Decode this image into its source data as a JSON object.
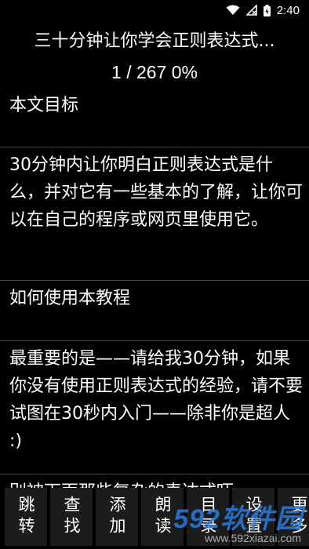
{
  "status_bar": {
    "time": "2:40",
    "icons": [
      "wifi-icon",
      "signal-icon",
      "battery-icon"
    ]
  },
  "header": {
    "title": "三十分钟让你学会正则表达式...",
    "progress": "1 / 267 0%"
  },
  "paragraphs": [
    "本文目标",
    "30分钟内让你明白正则表达式是什么，并对它有一些基本的了解，让你可以在自己的程序或网页里使用它。",
    "如何使用本教程",
    "最重要的是——请给我30分钟，如果你没有使用正则表达式的经验，请不要试图在30秒内入门——除非你是超人 :)",
    "别被下面那些复杂的表达式吓"
  ],
  "toolbar": [
    {
      "label": "跳转"
    },
    {
      "label": "查找"
    },
    {
      "label": "添加"
    },
    {
      "label": "朗读"
    },
    {
      "label": "目录"
    },
    {
      "label": "设置"
    },
    {
      "label": "更多"
    }
  ],
  "watermark": {
    "logo": "592软件园",
    "url": "www.592xiazai.com"
  },
  "colors": {
    "background": "#000000",
    "text": "#ffffff",
    "button": "#1c1c1c",
    "watermark": "#2a7de1"
  }
}
